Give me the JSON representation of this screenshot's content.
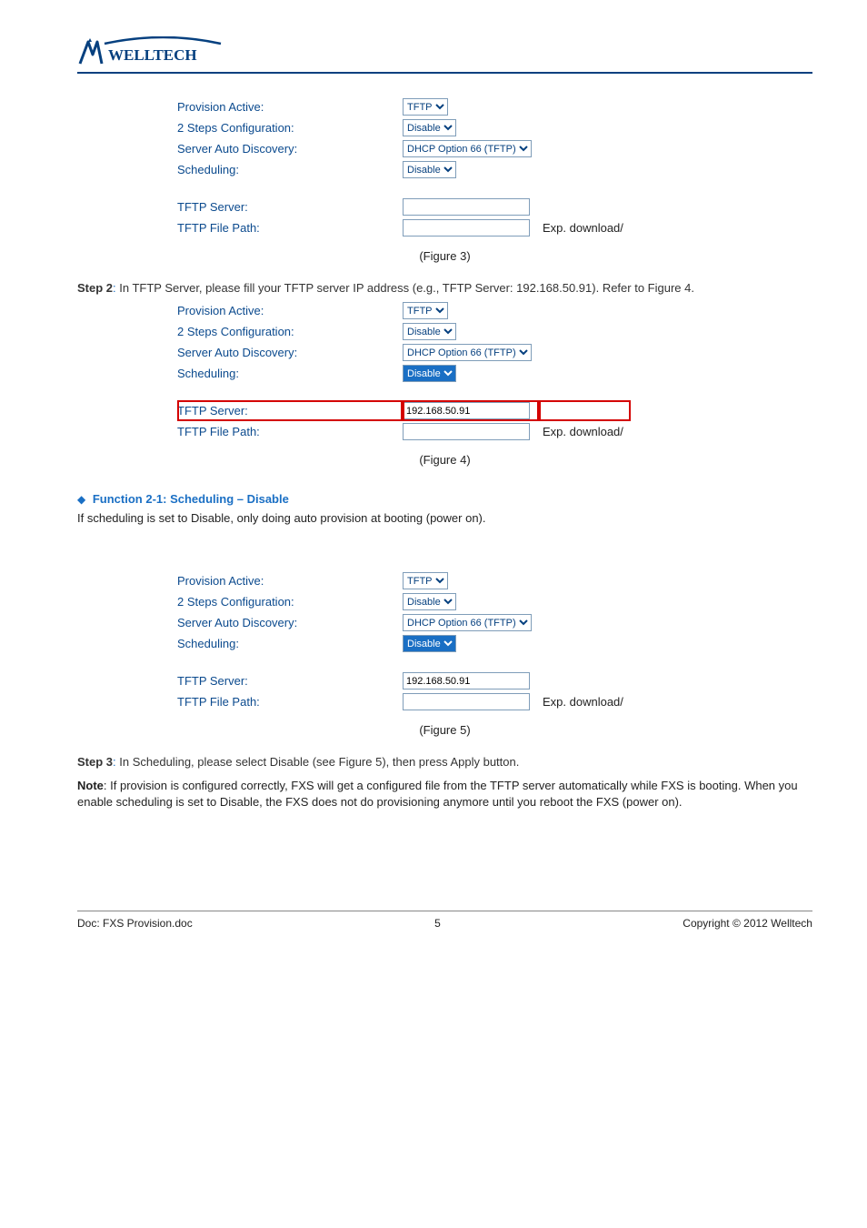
{
  "brand": "WELLTECH",
  "labels": {
    "prov": "Provision Active:",
    "steps": "2 Steps Configuration:",
    "auto": "Server Auto Discovery:",
    "sched": "Scheduling:",
    "srv": "TFTP Server:",
    "path": "TFTP File Path:"
  },
  "selects": {
    "tftp": "TFTP",
    "disable": "Disable",
    "dhcp66": "DHCP Option 66 (TFTP)"
  },
  "ext": "Exp. download/",
  "figure3": {
    "srv_val": "",
    "caption": "(Figure 3)"
  },
  "step2": {
    "prefix": "Step 2",
    "sep": ":",
    "text": "In TFTP Server, please fill your TFTP server IP address (e.g., TFTP Server: 192.168.50.91). Refer to Figure 4."
  },
  "figure4": {
    "srv_val": "192.168.50.91",
    "caption": "(Figure 4)"
  },
  "function_header": "Function 2-1: Scheduling – Disable",
  "scheduling_note": "If scheduling is set to Disable, only doing auto provision at booting (power on).",
  "figure5": {
    "srv_val": "192.168.50.91",
    "caption": "(Figure 5)"
  },
  "step3": {
    "prefix": "Step 3",
    "sep": ":",
    "text": "In Scheduling, please select Disable (see Figure 5), then press Apply button."
  },
  "note": {
    "prefix": "Note",
    "text": "If provision is configured correctly, FXS will get a configured file from the TFTP server automatically while FXS is booting. When you enable scheduling is set to Disable, the FXS does not do provisioning anymore until you reboot the FXS (power on)."
  },
  "footer": {
    "left": "Doc: FXS Provision.doc",
    "page": "5",
    "right": "Copyright © 2012 Welltech"
  }
}
